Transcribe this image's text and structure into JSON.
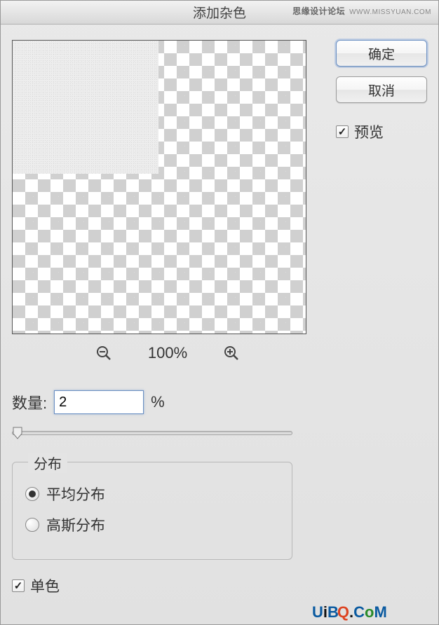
{
  "dialog": {
    "title": "添加杂色",
    "ok_label": "确定",
    "cancel_label": "取消",
    "preview_checkbox_label": "预览",
    "preview_checked": true
  },
  "zoom": {
    "level_text": "100%",
    "out_icon": "zoom-out",
    "in_icon": "zoom-in"
  },
  "amount": {
    "label": "数量:",
    "value": "2",
    "unit": "%"
  },
  "distribution": {
    "legend": "分布",
    "options": [
      {
        "label": "平均分布",
        "value": "uniform",
        "checked": true
      },
      {
        "label": "高斯分布",
        "value": "gaussian",
        "checked": false
      }
    ]
  },
  "monochrome": {
    "label": "单色",
    "checked": true
  },
  "watermark": {
    "top_bold": "思缘设计论坛",
    "top_url": "WWW.MISSYUAN.COM",
    "bottom": "UiBQ.CoM"
  }
}
